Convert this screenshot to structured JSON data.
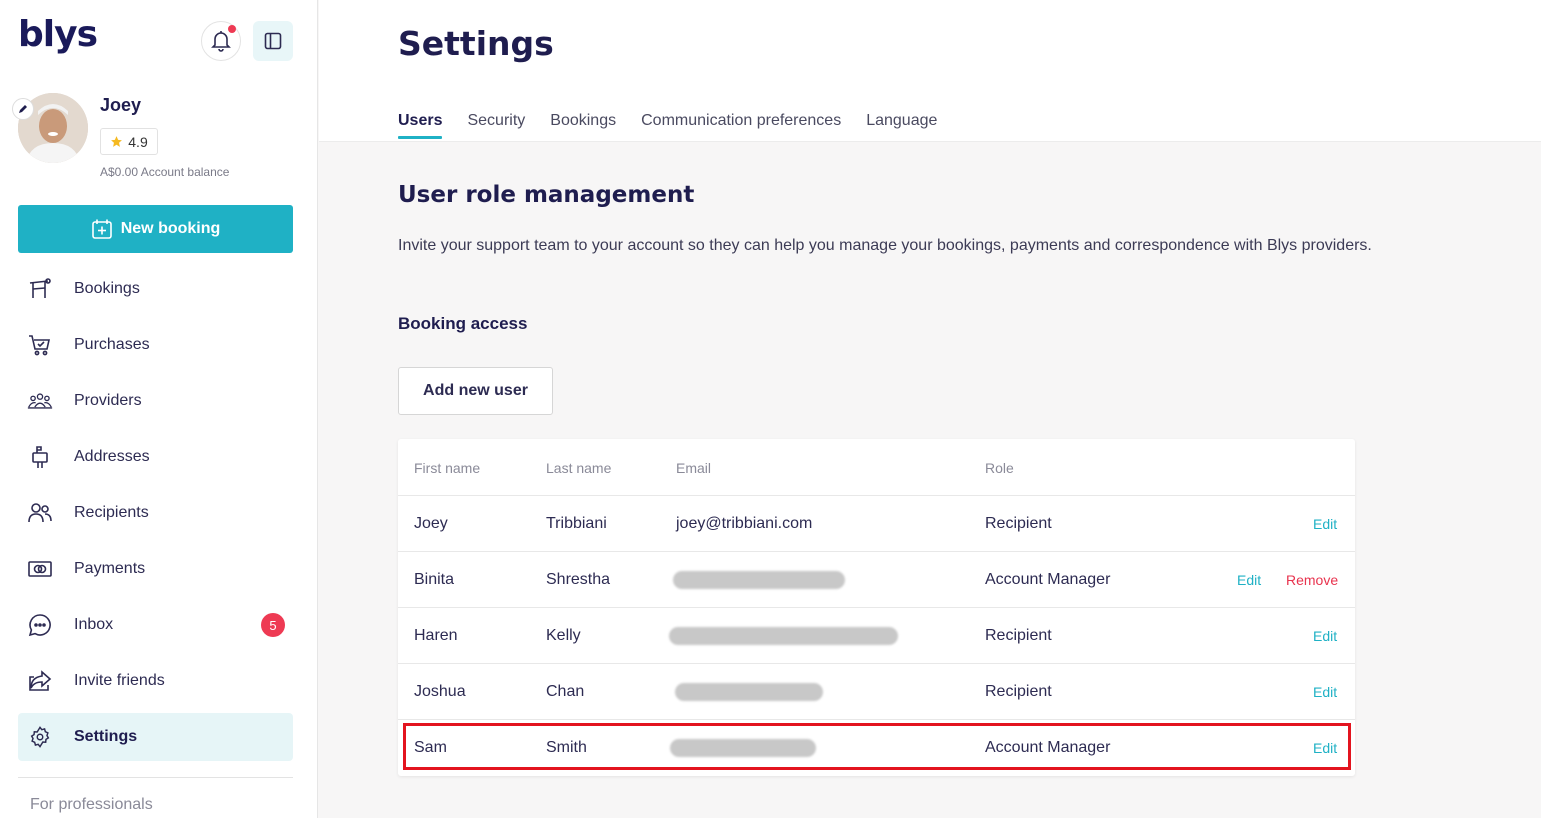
{
  "brand": {
    "logo": "blys",
    "accent": "#1fb1c5",
    "badge_color": "#ee3a53"
  },
  "profile": {
    "name": "Joey",
    "rating": "4.9",
    "balance": "A$0.00 Account balance"
  },
  "sidebar": {
    "new_booking": "New booking",
    "items": [
      {
        "label": "Bookings",
        "icon": "booking-table-icon"
      },
      {
        "label": "Purchases",
        "icon": "cart-icon"
      },
      {
        "label": "Providers",
        "icon": "group-icon"
      },
      {
        "label": "Addresses",
        "icon": "mailbox-icon"
      },
      {
        "label": "Recipients",
        "icon": "users-icon"
      },
      {
        "label": "Payments",
        "icon": "cash-icon"
      },
      {
        "label": "Inbox",
        "icon": "chat-icon",
        "badge": "5"
      },
      {
        "label": "Invite friends",
        "icon": "share-icon"
      },
      {
        "label": "Settings",
        "icon": "gear-icon",
        "active": true
      }
    ],
    "for_professionals": "For professionals"
  },
  "header": {
    "title": "Settings",
    "tabs": [
      "Users",
      "Security",
      "Bookings",
      "Communication preferences",
      "Language"
    ],
    "active_tab": "Users"
  },
  "main": {
    "section_title": "User role management",
    "section_desc": "Invite your support team to your account so they can help you manage your bookings, payments and correspondence with Blys providers.",
    "subsection": "Booking access",
    "add_user": "Add new user",
    "table": {
      "headers": [
        "First name",
        "Last name",
        "Email",
        "Role"
      ],
      "rows": [
        {
          "first": "Joey",
          "last": "Tribbiani",
          "email": "joey@tribbiani.com",
          "role": "Recipient",
          "edit": "Edit"
        },
        {
          "first": "Binita",
          "last": "Shrestha",
          "email": "",
          "email_redacted": true,
          "role": "Account Manager",
          "edit": "Edit",
          "remove": "Remove"
        },
        {
          "first": "Haren",
          "last": "Kelly",
          "email": "",
          "email_redacted": true,
          "role": "Recipient",
          "edit": "Edit"
        },
        {
          "first": "Joshua",
          "last": "Chan",
          "email": "",
          "email_redacted": true,
          "role": "Recipient",
          "edit": "Edit"
        },
        {
          "first": "Sam",
          "last": "Smith",
          "email": "",
          "email_redacted": true,
          "role": "Account Manager",
          "edit": "Edit",
          "highlighted": true
        }
      ]
    }
  }
}
